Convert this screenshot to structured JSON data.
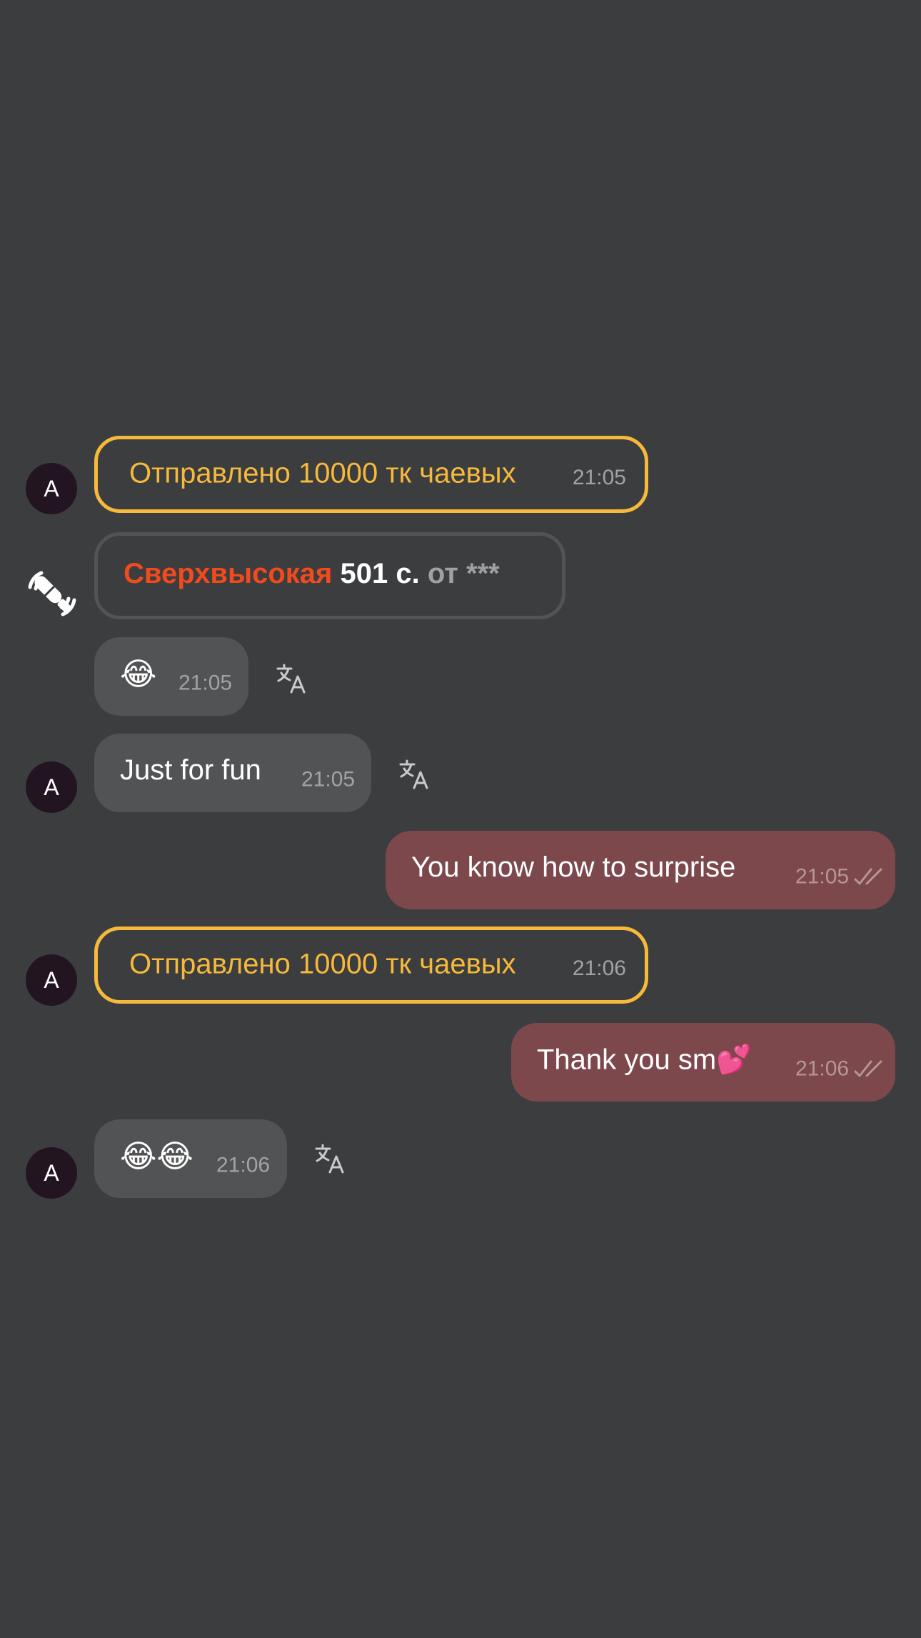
{
  "messages": {
    "tip1": {
      "avatar_letter": "A",
      "text": "Отправлено 10000 тк чаевых",
      "time": "21:05"
    },
    "gift": {
      "name": "Сверхвысокая",
      "duration": "501 с.",
      "from": "от ***"
    },
    "emoji1": {
      "emoji": "😂",
      "time": "21:05"
    },
    "msg_in1": {
      "avatar_letter": "A",
      "text": "Just for fun",
      "time": "21:05"
    },
    "msg_out1": {
      "text": "You know how to surprise",
      "time": "21:05"
    },
    "tip2": {
      "avatar_letter": "A",
      "text": "Отправлено 10000 тк чаевых",
      "time": "21:06"
    },
    "msg_out2": {
      "text": "Thank you sm💕",
      "time": "21:06"
    },
    "emoji2": {
      "avatar_letter": "A",
      "emoji": "😂😂",
      "time": "21:06"
    }
  },
  "colors": {
    "background": "#3c3d3f",
    "tip_accent": "#f6b93b",
    "gift_name": "#f04a1d",
    "incoming_bubble": "#525355",
    "outgoing_bubble": "#7c484c",
    "avatar_bg": "#231421"
  },
  "icons": {
    "gift_sender": "toy-vibe-icon",
    "translate": "translate-icon",
    "read_status": "double-check-icon"
  }
}
